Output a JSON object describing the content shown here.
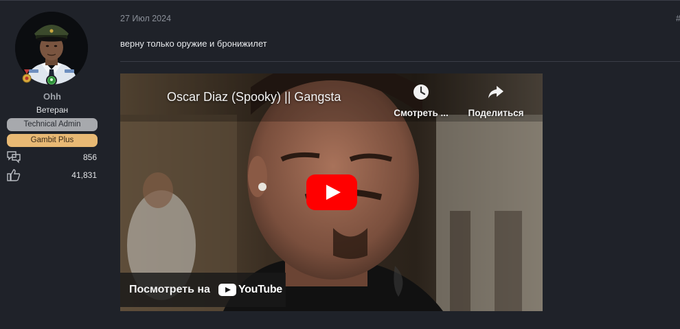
{
  "user": {
    "name": "Ohh",
    "title": "Ветеран",
    "banners": [
      "Technical Admin",
      "Gambit Plus"
    ],
    "messages_count": "856",
    "reactions_count": "41,831"
  },
  "post": {
    "date": "27 Июл 2024",
    "hash": "#",
    "text": "верну только оружие и бронижилет"
  },
  "video": {
    "title": "Oscar Diaz (Spooky) || Gangsta",
    "watch_later_label": "Смотреть ...",
    "share_label": "Поделиться",
    "watch_on_label": "Посмотреть на",
    "youtube_word": "YouTube"
  },
  "colors": {
    "background": "#1f2229",
    "admin_banner": "#a7a9ad",
    "gambit_banner": "#e8b974",
    "youtube_red": "#ff0000"
  }
}
